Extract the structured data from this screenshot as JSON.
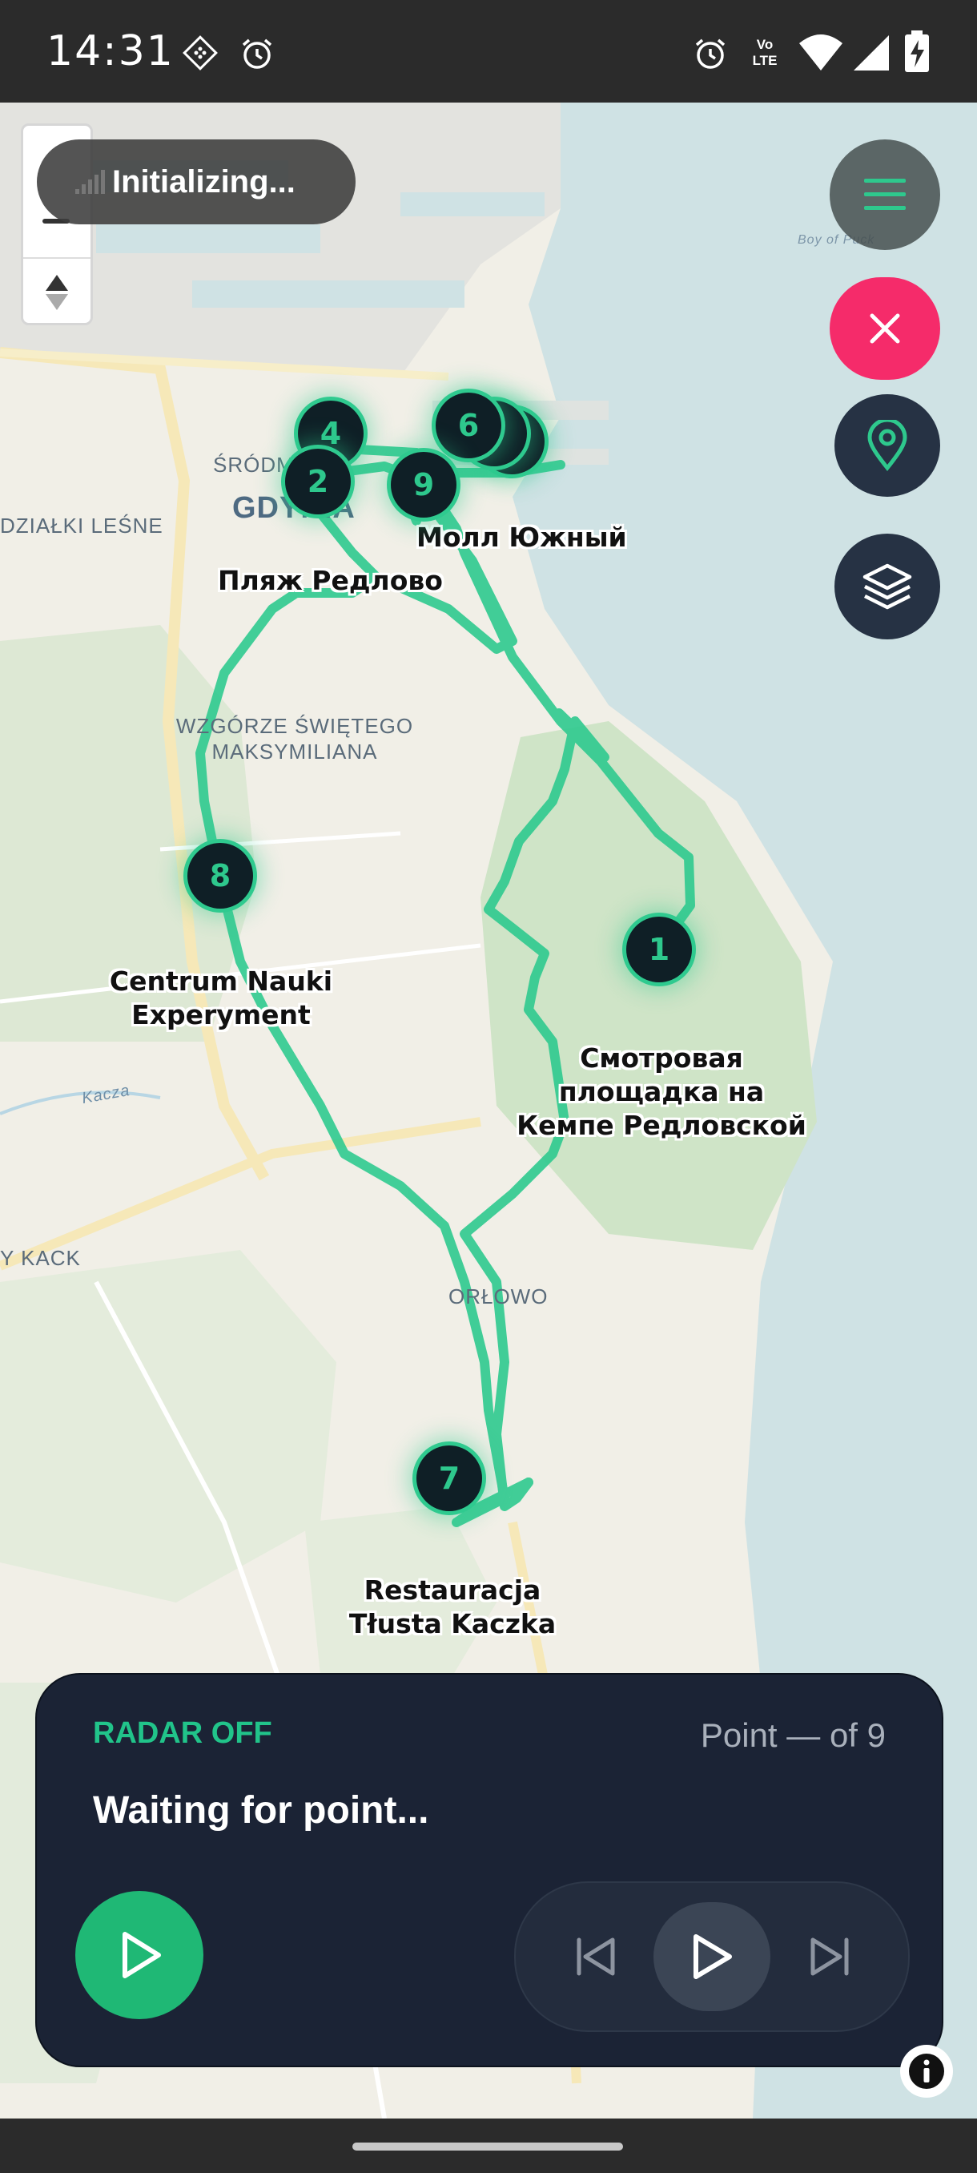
{
  "status_bar": {
    "time": "14:31",
    "icons_left": [
      "diamond-grid-icon",
      "alarm-icon"
    ],
    "icons_right": [
      "alarm-icon",
      "volte-icon",
      "wifi-icon",
      "cell-signal-icon",
      "battery-charging-icon"
    ],
    "volte_text": "Vo LTE"
  },
  "map": {
    "toast": "Initializing...",
    "area_labels": [
      {
        "text": "ŚRÓDM"
      },
      {
        "text": "GDYNIA"
      },
      {
        "text": "DZIAŁKI LEŚNE"
      },
      {
        "text": "WZGÓRZE ŚWIĘTEGO MAKSYMILIANA"
      },
      {
        "text": "Y KACK"
      },
      {
        "text": "ORŁOWO"
      },
      {
        "text": "Kacza"
      },
      {
        "text": "Boy of Puck"
      }
    ],
    "poi_labels": [
      {
        "text": "Молл Южный"
      },
      {
        "text": "Пляж Редлово"
      },
      {
        "text": "Centrum Nauki Experyment"
      },
      {
        "text": "Смотровая площадка на Кемпе Редловской"
      },
      {
        "text": "Restauracja Tłusta Kaczka"
      }
    ],
    "markers": [
      "1",
      "2",
      "4",
      "6",
      "7",
      "8",
      "9"
    ],
    "route_color": "#2fca8f"
  },
  "fabs": {
    "menu": "menu-icon",
    "close": "close-icon",
    "location": "location-pin-icon",
    "layers": "layers-icon"
  },
  "panel": {
    "radar_status": "RADAR OFF",
    "point_counter": "Point — of 9",
    "message": "Waiting for point...",
    "accent": "#21c48a"
  }
}
